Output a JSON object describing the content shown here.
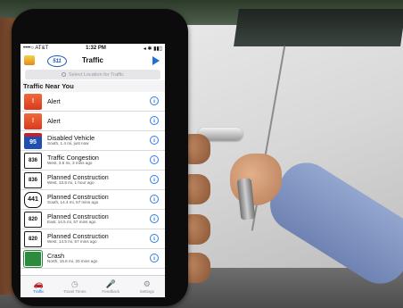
{
  "status_bar": {
    "carrier": "••••○ AT&T",
    "time": "1:32 PM",
    "battery": "◂ ✱ ▮▮▯"
  },
  "nav": {
    "title": "Traffic",
    "logo_text": "511"
  },
  "search": {
    "placeholder": "Select Location for Traffic"
  },
  "section_header": "Traffic Near You",
  "incidents": [
    {
      "icon": "alert-icon",
      "icon_text": "!",
      "title": "Alert",
      "subtitle": ""
    },
    {
      "icon": "alert-icon",
      "icon_text": "!",
      "title": "Alert",
      "subtitle": ""
    },
    {
      "icon": "i95-shield-icon",
      "icon_text": "95",
      "title": "Disabled Vehicle",
      "subtitle": "South, 1.4 mi, just now"
    },
    {
      "icon": "toll-836-shield-icon",
      "icon_text": "836",
      "title": "Traffic Congestion",
      "subtitle": "West, 3.5 mi, 3 mins ago"
    },
    {
      "icon": "toll-836-shield-icon",
      "icon_text": "836",
      "title": "Planned Construction",
      "subtitle": "West, 13.8 mi, 1 hour ago"
    },
    {
      "icon": "us-441-shield-icon",
      "icon_text": "441",
      "title": "Planned Construction",
      "subtitle": "South, 14.4 mi, 57 mins ago"
    },
    {
      "icon": "toll-820-shield-icon",
      "icon_text": "820",
      "title": "Planned Construction",
      "subtitle": "East, 14.5 mi, 57 mins ago"
    },
    {
      "icon": "toll-820-shield-icon",
      "icon_text": "820",
      "title": "Planned Construction",
      "subtitle": "West, 14.5 mi, 57 mins ago"
    },
    {
      "icon": "state-road-shield-icon",
      "icon_text": "",
      "title": "Crash",
      "subtitle": "North, 15.6 mi, 20 mins ago"
    }
  ],
  "tabs": [
    {
      "label": "Traffic",
      "glyph": "🚗",
      "active": true
    },
    {
      "label": "Travel Times",
      "glyph": "◷",
      "active": false
    },
    {
      "label": "Feedback",
      "glyph": "🎤",
      "active": false
    },
    {
      "label": "Settings",
      "glyph": "⚙",
      "active": false
    }
  ],
  "colors": {
    "accent": "#1e6fd9",
    "alert": "#e4482a",
    "interstate": "#1f4fb1",
    "sleeve": "#7f93c2"
  }
}
